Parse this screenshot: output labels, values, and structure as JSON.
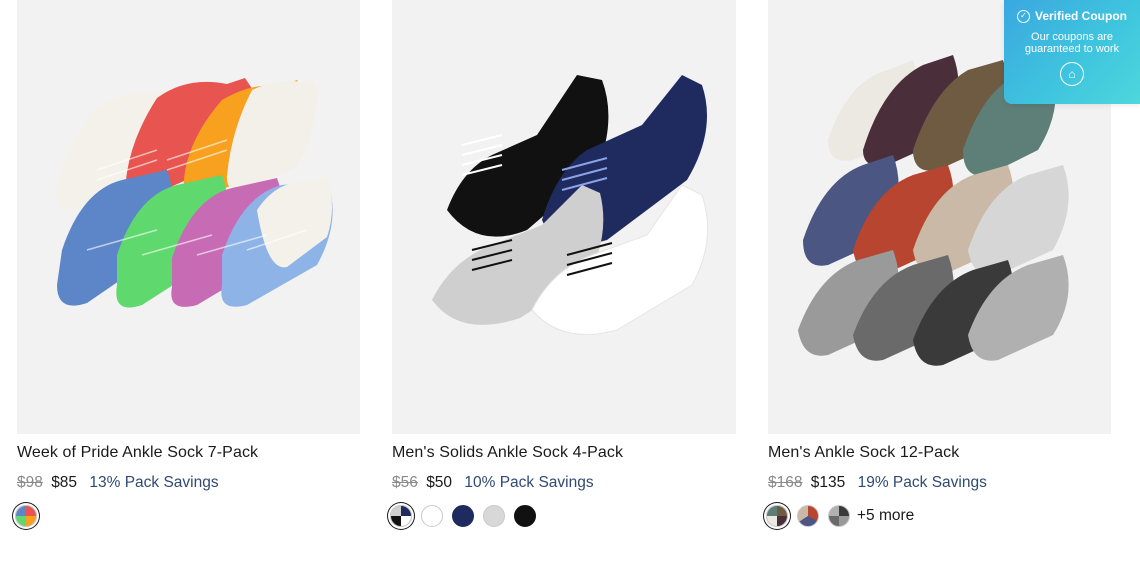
{
  "products": [
    {
      "title": "Week of Pride Ankle Sock 7-Pack",
      "original_price": "$98",
      "sale_price": "$85",
      "savings": "13% Pack Savings"
    },
    {
      "title": "Men's Solids Ankle Sock 4-Pack",
      "original_price": "$56",
      "sale_price": "$50",
      "savings": "10% Pack Savings"
    },
    {
      "title": "Men's Ankle Sock 12-Pack",
      "original_price": "$168",
      "sale_price": "$135",
      "savings": "19% Pack Savings",
      "more_label": "+5 more"
    }
  ],
  "coupon": {
    "title": "Verified Coupon",
    "subtitle": "Our coupons are guaranteed to work"
  },
  "colors": {
    "savings_text": "#2f4a73",
    "coupon_bg": "#3fc6de",
    "image_bg": "#f2f2f2"
  }
}
